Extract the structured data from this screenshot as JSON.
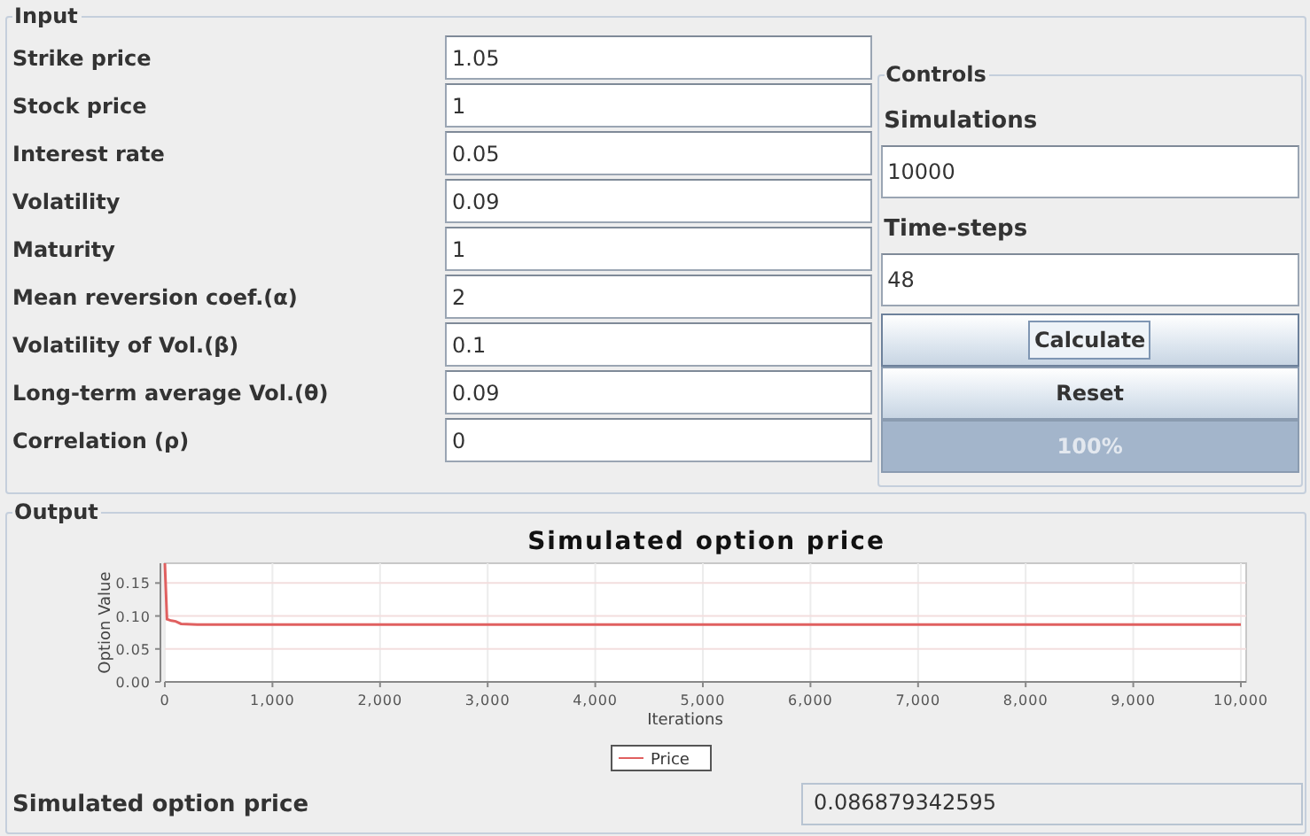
{
  "input": {
    "title": "Input",
    "params": [
      {
        "label": "Strike price",
        "value": "1.05"
      },
      {
        "label": "Stock price",
        "value": "1"
      },
      {
        "label": "Interest rate",
        "value": "0.05"
      },
      {
        "label": "Volatility",
        "value": "0.09"
      },
      {
        "label": "Maturity",
        "value": "1"
      },
      {
        "label": "Mean reversion coef.(α)",
        "value": "2"
      },
      {
        "label": "Volatility of Vol.(β)",
        "value": "0.1"
      },
      {
        "label": "Long-term average Vol.(θ)",
        "value": "0.09"
      },
      {
        "label": "Correlation (ρ)",
        "value": "0"
      }
    ]
  },
  "controls": {
    "title": "Controls",
    "fields": [
      {
        "label": "Simulations",
        "value": "10000"
      },
      {
        "label": "Time-steps",
        "value": "48"
      }
    ],
    "buttons": [
      {
        "label": "Calculate",
        "focused": true
      },
      {
        "label": "Reset",
        "focused": false
      }
    ],
    "progress": {
      "level": 1,
      "text": "100%"
    }
  },
  "output": {
    "title": "Output",
    "chart_data": {
      "type": "line",
      "title": "Simulated option price",
      "xlabel": "Iterations",
      "ylabel": "Option Value",
      "x": [
        0,
        20,
        60,
        100,
        150,
        300,
        1000,
        2000,
        3000,
        4000,
        5000,
        6000,
        7000,
        8000,
        9000,
        10000
      ],
      "series": [
        {
          "name": "Price",
          "color": "#e06060",
          "values": [
            0.18,
            0.095,
            0.093,
            0.092,
            0.088,
            0.087,
            0.087,
            0.087,
            0.087,
            0.087,
            0.087,
            0.087,
            0.087,
            0.087,
            0.087,
            0.087
          ]
        }
      ],
      "grid": true,
      "xlim": [
        0,
        10000
      ],
      "ylim": [
        0,
        0.18
      ],
      "xticks": [
        {
          "value": 0,
          "label": "0"
        },
        {
          "value": 1000,
          "label": "1,000"
        },
        {
          "value": 2000,
          "label": "2,000"
        },
        {
          "value": 3000,
          "label": "3,000"
        },
        {
          "value": 4000,
          "label": "4,000"
        },
        {
          "value": 5000,
          "label": "5,000"
        },
        {
          "value": 6000,
          "label": "6,000"
        },
        {
          "value": 7000,
          "label": "7,000"
        },
        {
          "value": 8000,
          "label": "8,000"
        },
        {
          "value": 9000,
          "label": "9,000"
        },
        {
          "value": 10000,
          "label": "10,000"
        }
      ],
      "yticks": [
        {
          "value": 0,
          "label": "0.00"
        },
        {
          "value": 0.05,
          "label": "0.05"
        },
        {
          "value": 0.1,
          "label": "0.10"
        },
        {
          "value": 0.15,
          "label": "0.15"
        }
      ]
    },
    "result_label": "Simulated option price",
    "result_value": "0.086879342595"
  }
}
